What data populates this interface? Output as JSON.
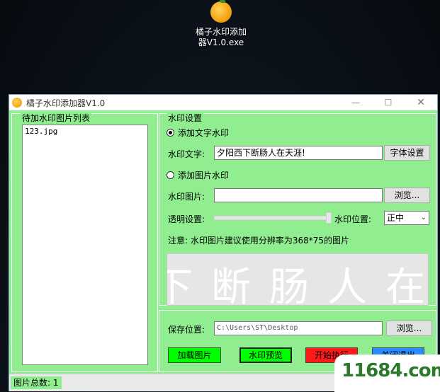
{
  "desktop": {
    "icon_label_line1": "橘子水印添加",
    "icon_label_line2": "器V1.0.exe",
    "site_mark": "11684.com"
  },
  "window": {
    "title": "橘子水印添加器V1.0",
    "min_glyph": "—",
    "max_glyph": "☐",
    "close_glyph": "✕"
  },
  "left_panel": {
    "legend": "待加水印图片列表",
    "files": [
      "123.jpg"
    ]
  },
  "settings": {
    "legend": "水印设置",
    "text_radio_label": "添加文字水印",
    "text_radio_checked": true,
    "text_label": "水印文字:",
    "text_value": "夕阳西下断肠人在天涯!",
    "font_button": "字体设置",
    "image_radio_label": "添加图片水印",
    "image_radio_checked": false,
    "image_label": "水印图片:",
    "image_value": "",
    "browse_button": "浏览...",
    "opacity_label": "透明设置:",
    "opacity_level": 1.0,
    "position_label": "水印位置:",
    "position_value": "正中",
    "note": "注意: 水印图片建议使用分辨率为368*75的图片",
    "preview_text": "下断肠人在"
  },
  "save": {
    "label": "保存位置:",
    "path": "C:\\Users\\ST\\Desktop",
    "browse_button": "浏览...",
    "load_button": "加载图片",
    "preview_button": "水印预览",
    "start_button": "开始执行",
    "close_button": "关闭退出"
  },
  "colors": {
    "panel_bg": "#90ee90",
    "load_btn": "#00ff00",
    "preview_btn": "#00ff00",
    "start_btn": "#ff0000",
    "close_btn": "#1e90ff"
  },
  "status": {
    "count_text": "图片总数: 1"
  }
}
